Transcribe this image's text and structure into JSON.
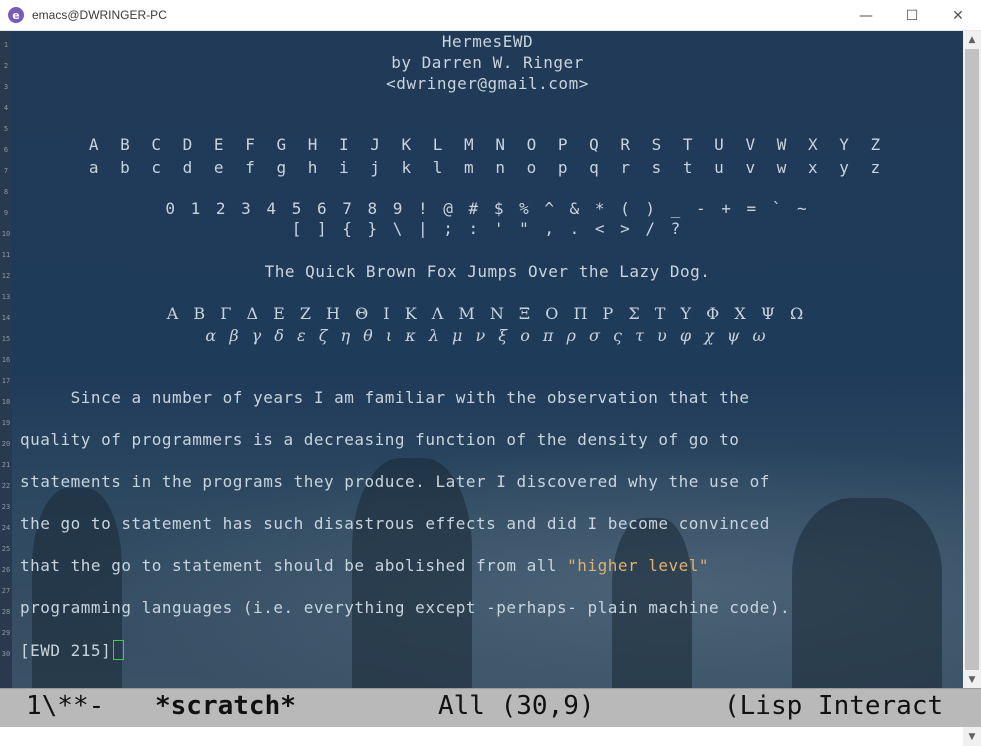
{
  "window": {
    "title": "emacs@DWRINGER-PC",
    "app_icon_letter": "e",
    "minimize_glyph": "—",
    "maximize_glyph": "☐",
    "close_glyph": "✕"
  },
  "line_numbers": [
    "1",
    "2",
    "3",
    "4",
    "5",
    "6",
    "7",
    "8",
    "9",
    "10",
    "11",
    "12",
    "13",
    "14",
    "15",
    "16",
    "17",
    "18",
    "19",
    "20",
    "21",
    "22",
    "23",
    "24",
    "25",
    "26",
    "27",
    "28",
    "29",
    "30"
  ],
  "buffer": {
    "heading_title": "HermesEWD",
    "heading_author": "by Darren W. Ringer",
    "heading_email": "<dwringer@gmail.com>",
    "upper_alpha": "A B C D E F G H I J K L M N O P Q R S T U V W X Y Z",
    "lower_alpha": "a b c d e f g h i j k l m n o p q r s t u v w x y z",
    "digits_symbols": "0 1 2 3 4 5 6 7 8 9 ! @ # $ % ^ & * ( ) _ - + = ` ~",
    "brackets": "[ ] { } \\ | ; : ' \" , . < > / ?",
    "pangram": "The Quick Brown Fox Jumps Over the Lazy Dog.",
    "greek_upper": "Α Β Γ Δ Ε Ζ Η Θ Ι Κ Λ Μ Ν Ξ Ο Π Ρ Σ Τ Υ Φ Χ Ψ Ω",
    "greek_lower": "α β γ δ ε ζ η θ ι κ λ μ ν ξ ο π ρ σ ς τ υ φ χ ψ ω",
    "para_line1": "     Since a number of years I am familiar with the observation that the",
    "para_line2": "quality of programmers is a decreasing function of the density of go to",
    "para_line3": "statements in the programs they produce. Later I discovered why the use of",
    "para_line4": "the go to statement has such disastrous effects and did I become convinced",
    "para_line5_prefix": "that the go to statement should be abolished from all ",
    "para_line5_string": "\"higher level\"",
    "para_line6": "programming languages (i.e. everything except -perhaps- plain machine code).",
    "para_line7": "[EWD 215]"
  },
  "modeline": {
    "status": "1\\**-",
    "buffer_name": "*scratch*",
    "position": "All (30,9)",
    "mode": "(Lisp Interact"
  },
  "colors": {
    "editor_bg": "#1f3b5a",
    "text": "#c9d3dc",
    "string": "#e0b070",
    "cursor": "#3ad13a",
    "modeline_bg": "#b9b9b9"
  }
}
